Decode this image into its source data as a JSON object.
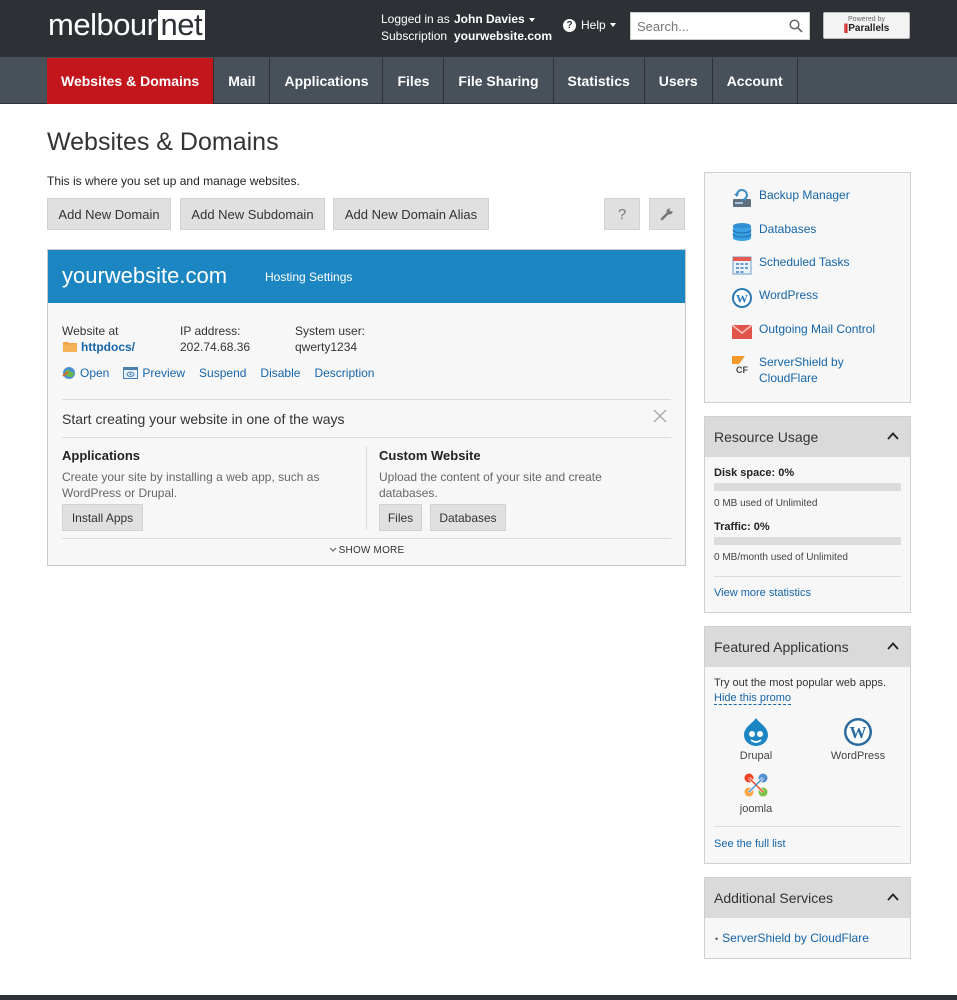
{
  "header": {
    "logo_part1": "melbour",
    "logo_part2": "net",
    "login_label": "Logged in as",
    "login_user": "John Davies",
    "subscription_label": "Subscription",
    "subscription_value": "yourwebsite.com",
    "help_label": "Help",
    "search_placeholder": "Search...",
    "powered_by": "Powered by",
    "parallels": "Parallels"
  },
  "nav": {
    "tabs": [
      {
        "label": "Websites & Domains",
        "active": true
      },
      {
        "label": "Mail"
      },
      {
        "label": "Applications"
      },
      {
        "label": "Files"
      },
      {
        "label": "File Sharing"
      },
      {
        "label": "Statistics"
      },
      {
        "label": "Users"
      },
      {
        "label": "Account"
      }
    ]
  },
  "main": {
    "title": "Websites & Domains",
    "description": "This is where you set up and manage websites.",
    "buttons": {
      "add_domain": "Add New Domain",
      "add_subdomain": "Add New Subdomain",
      "add_alias": "Add New Domain Alias",
      "help": "?"
    },
    "domain": {
      "name": "yourwebsite.com",
      "hosting_settings": "Hosting Settings",
      "website_at_label": "Website at",
      "website_at_value": "httpdocs/",
      "ip_label": "IP address:",
      "ip_value": "202.74.68.36",
      "sysuser_label": "System user:",
      "sysuser_value": "qwerty1234",
      "actions": {
        "open": "Open",
        "preview": "Preview",
        "suspend": "Suspend",
        "disable": "Disable",
        "description": "Description"
      },
      "start_text": "Start creating your website in one of the ways",
      "applications": {
        "title": "Applications",
        "text_line1": "Create your site by installing a web app, such as",
        "text_line2": "WordPress or Drupal.",
        "button": "Install Apps"
      },
      "custom": {
        "title": "Custom Website",
        "text_line1": "Upload the content of your site and create",
        "text_line2": "databases.",
        "button_files": "Files",
        "button_databases": "Databases"
      },
      "show_more": "SHOW MORE"
    }
  },
  "sidebar": {
    "tools": [
      {
        "label": "Backup Manager",
        "icon": "backup-icon"
      },
      {
        "label": "Databases",
        "icon": "database-icon"
      },
      {
        "label": "Scheduled Tasks",
        "icon": "calendar-icon"
      },
      {
        "label": "WordPress",
        "icon": "wordpress-icon"
      },
      {
        "label": "Outgoing Mail Control",
        "icon": "mail-icon"
      },
      {
        "label_line1": "ServerShield by",
        "label_line2": "CloudFlare",
        "icon": "cloudflare-icon"
      }
    ],
    "resource_usage": {
      "title": "Resource Usage",
      "disk_label": "Disk space: 0%",
      "disk_fraction": 0,
      "disk_sub": "0 MB used of Unlimited",
      "traffic_label": "Traffic: 0%",
      "traffic_fraction": 0,
      "traffic_sub": "0 MB/month used of Unlimited",
      "more_stats": "View more statistics"
    },
    "featured": {
      "title": "Featured Applications",
      "description": "Try out the most popular web apps.",
      "hide": "Hide this promo",
      "apps": [
        "Drupal",
        "WordPress",
        "joomla"
      ],
      "full_list": "See the full list"
    },
    "additional": {
      "title": "Additional Services",
      "item": "ServerShield by CloudFlare"
    }
  },
  "colors": {
    "header_bg": "#2d3136",
    "nav_bg": "#48505a",
    "active_tab": "#c3161c",
    "domain_header": "#1c86c2",
    "link": "#1565a8"
  }
}
